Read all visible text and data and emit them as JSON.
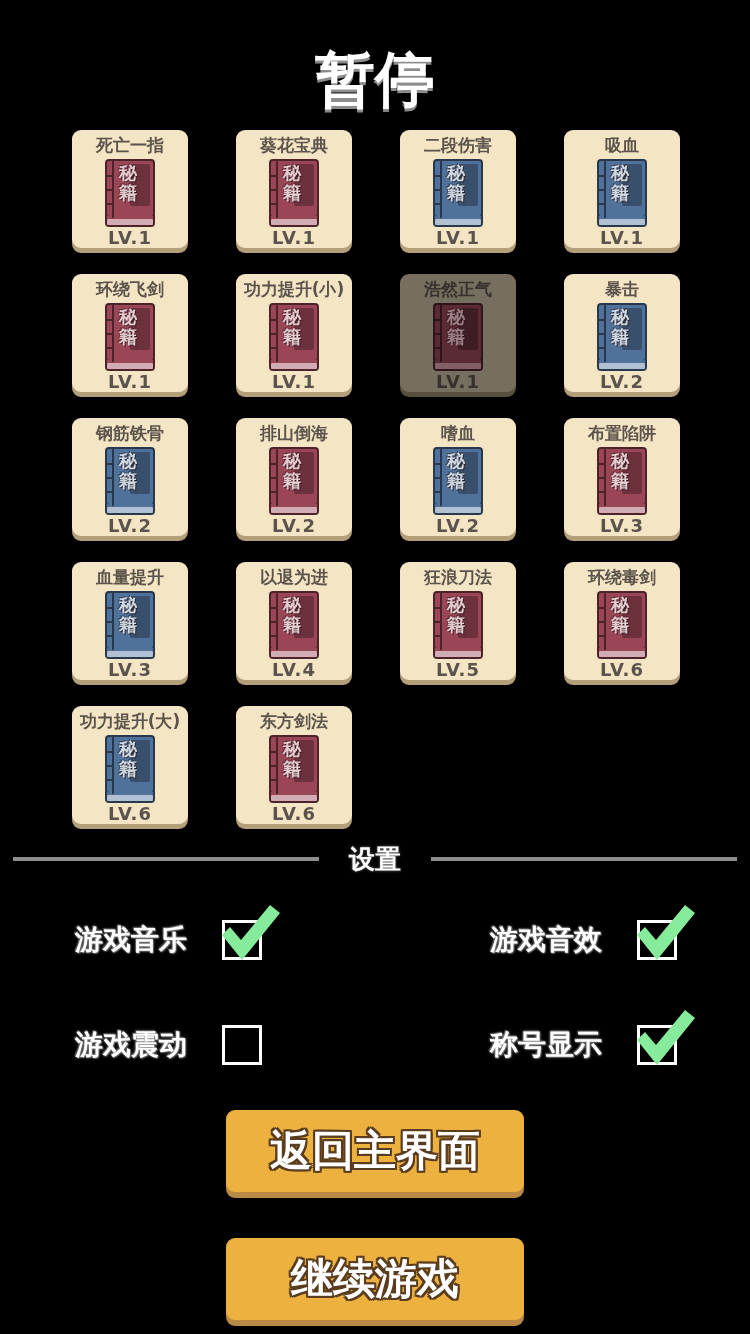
{
  "title": "暂停",
  "skills": [
    {
      "name": "死亡一指",
      "cover": "秘籍",
      "level": "LV.1",
      "color": "#9a4656",
      "disabled": false
    },
    {
      "name": "葵花宝典",
      "cover": "秘籍",
      "level": "LV.1",
      "color": "#9a4656",
      "disabled": false
    },
    {
      "name": "二段伤害",
      "cover": "秘籍",
      "level": "LV.1",
      "color": "#50729a",
      "disabled": false
    },
    {
      "name": "吸血",
      "cover": "秘籍",
      "level": "LV.1",
      "color": "#50729a",
      "disabled": false
    },
    {
      "name": "环绕飞剑",
      "cover": "秘籍",
      "level": "LV.1",
      "color": "#9a4656",
      "disabled": false
    },
    {
      "name": "功力提升(小)",
      "cover": "秘籍",
      "level": "LV.1",
      "color": "#9a4656",
      "disabled": false
    },
    {
      "name": "浩然正气",
      "cover": "秘籍",
      "level": "LV.1",
      "color": "#5a2a35",
      "disabled": true
    },
    {
      "name": "暴击",
      "cover": "秘籍",
      "level": "LV.2",
      "color": "#50729a",
      "disabled": false
    },
    {
      "name": "钢筋铁骨",
      "cover": "秘籍",
      "level": "LV.2",
      "color": "#50729a",
      "disabled": false
    },
    {
      "name": "排山倒海",
      "cover": "秘籍",
      "level": "LV.2",
      "color": "#9a4656",
      "disabled": false
    },
    {
      "name": "嗜血",
      "cover": "秘籍",
      "level": "LV.2",
      "color": "#50729a",
      "disabled": false
    },
    {
      "name": "布置陷阱",
      "cover": "秘籍",
      "level": "LV.3",
      "color": "#9a4656",
      "disabled": false
    },
    {
      "name": "血量提升",
      "cover": "秘籍",
      "level": "LV.3",
      "color": "#50729a",
      "disabled": false
    },
    {
      "name": "以退为进",
      "cover": "秘籍",
      "level": "LV.4",
      "color": "#9a4656",
      "disabled": false
    },
    {
      "name": "狂浪刀法",
      "cover": "秘籍",
      "level": "LV.5",
      "color": "#9a4656",
      "disabled": false
    },
    {
      "name": "环绕毒剑",
      "cover": "秘籍",
      "level": "LV.6",
      "color": "#9a4656",
      "disabled": false
    },
    {
      "name": "功力提升(大)",
      "cover": "秘籍",
      "level": "LV.6",
      "color": "#50729a",
      "disabled": false
    },
    {
      "name": "东方剑法",
      "cover": "秘籍",
      "level": "LV.6",
      "color": "#9a4656",
      "disabled": false
    }
  ],
  "settings_header": "设置",
  "settings": [
    {
      "label": "游戏音乐",
      "checked": true
    },
    {
      "label": "游戏音效",
      "checked": true
    },
    {
      "label": "游戏震动",
      "checked": false
    },
    {
      "label": "称号显示",
      "checked": true
    }
  ],
  "buttons": [
    {
      "label": "返回主界面"
    },
    {
      "label": "继续游戏"
    }
  ]
}
